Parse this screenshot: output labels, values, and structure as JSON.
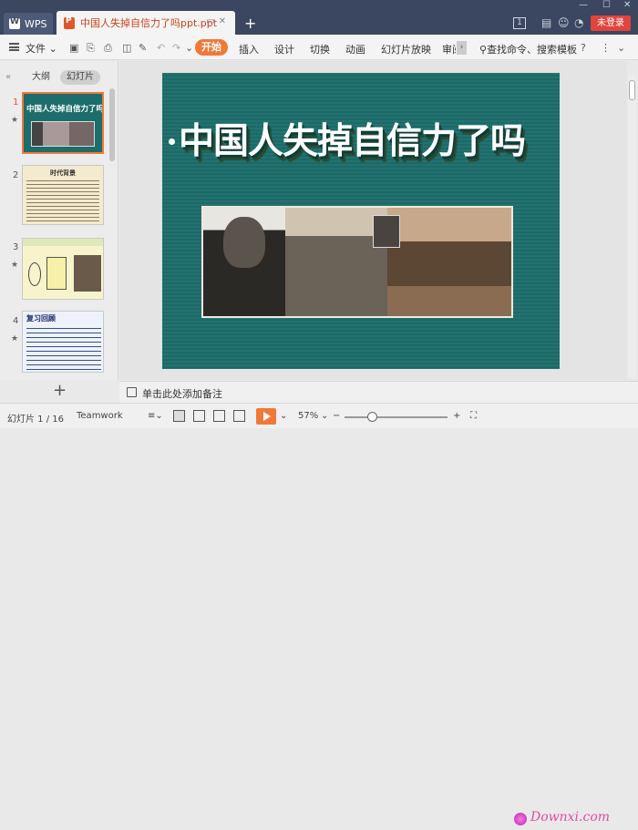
{
  "titlebar": {
    "app_tab": "WPS",
    "doc_tab": "中国人失掉自信力了吗ppt.ppt",
    "page_badge": "1",
    "login": "未登录"
  },
  "menubar": {
    "file": "文件",
    "tabs": [
      "开始",
      "插入",
      "设计",
      "切换",
      "动画",
      "幻灯片放映",
      "审阅"
    ],
    "search": "查找命令、搜索模板",
    "help": "?"
  },
  "left_panel": {
    "view_tabs": [
      "大纲",
      "幻灯片"
    ],
    "slides": [
      {
        "num": "1",
        "title": "中国人失掉自信力了吗"
      },
      {
        "num": "2",
        "title": "时代背景"
      },
      {
        "num": "3",
        "title": ""
      },
      {
        "num": "4",
        "title": "复习回顾"
      }
    ]
  },
  "slide": {
    "title": "中国人失掉自信力了吗",
    "bg_color": "#1c6d6b"
  },
  "notes": {
    "placeholder": "单击此处添加备注"
  },
  "statusbar": {
    "slide_info": "幻灯片 1 / 16",
    "theme": "Teamwork",
    "zoom": "57%",
    "watermark": "Downxi.com"
  }
}
